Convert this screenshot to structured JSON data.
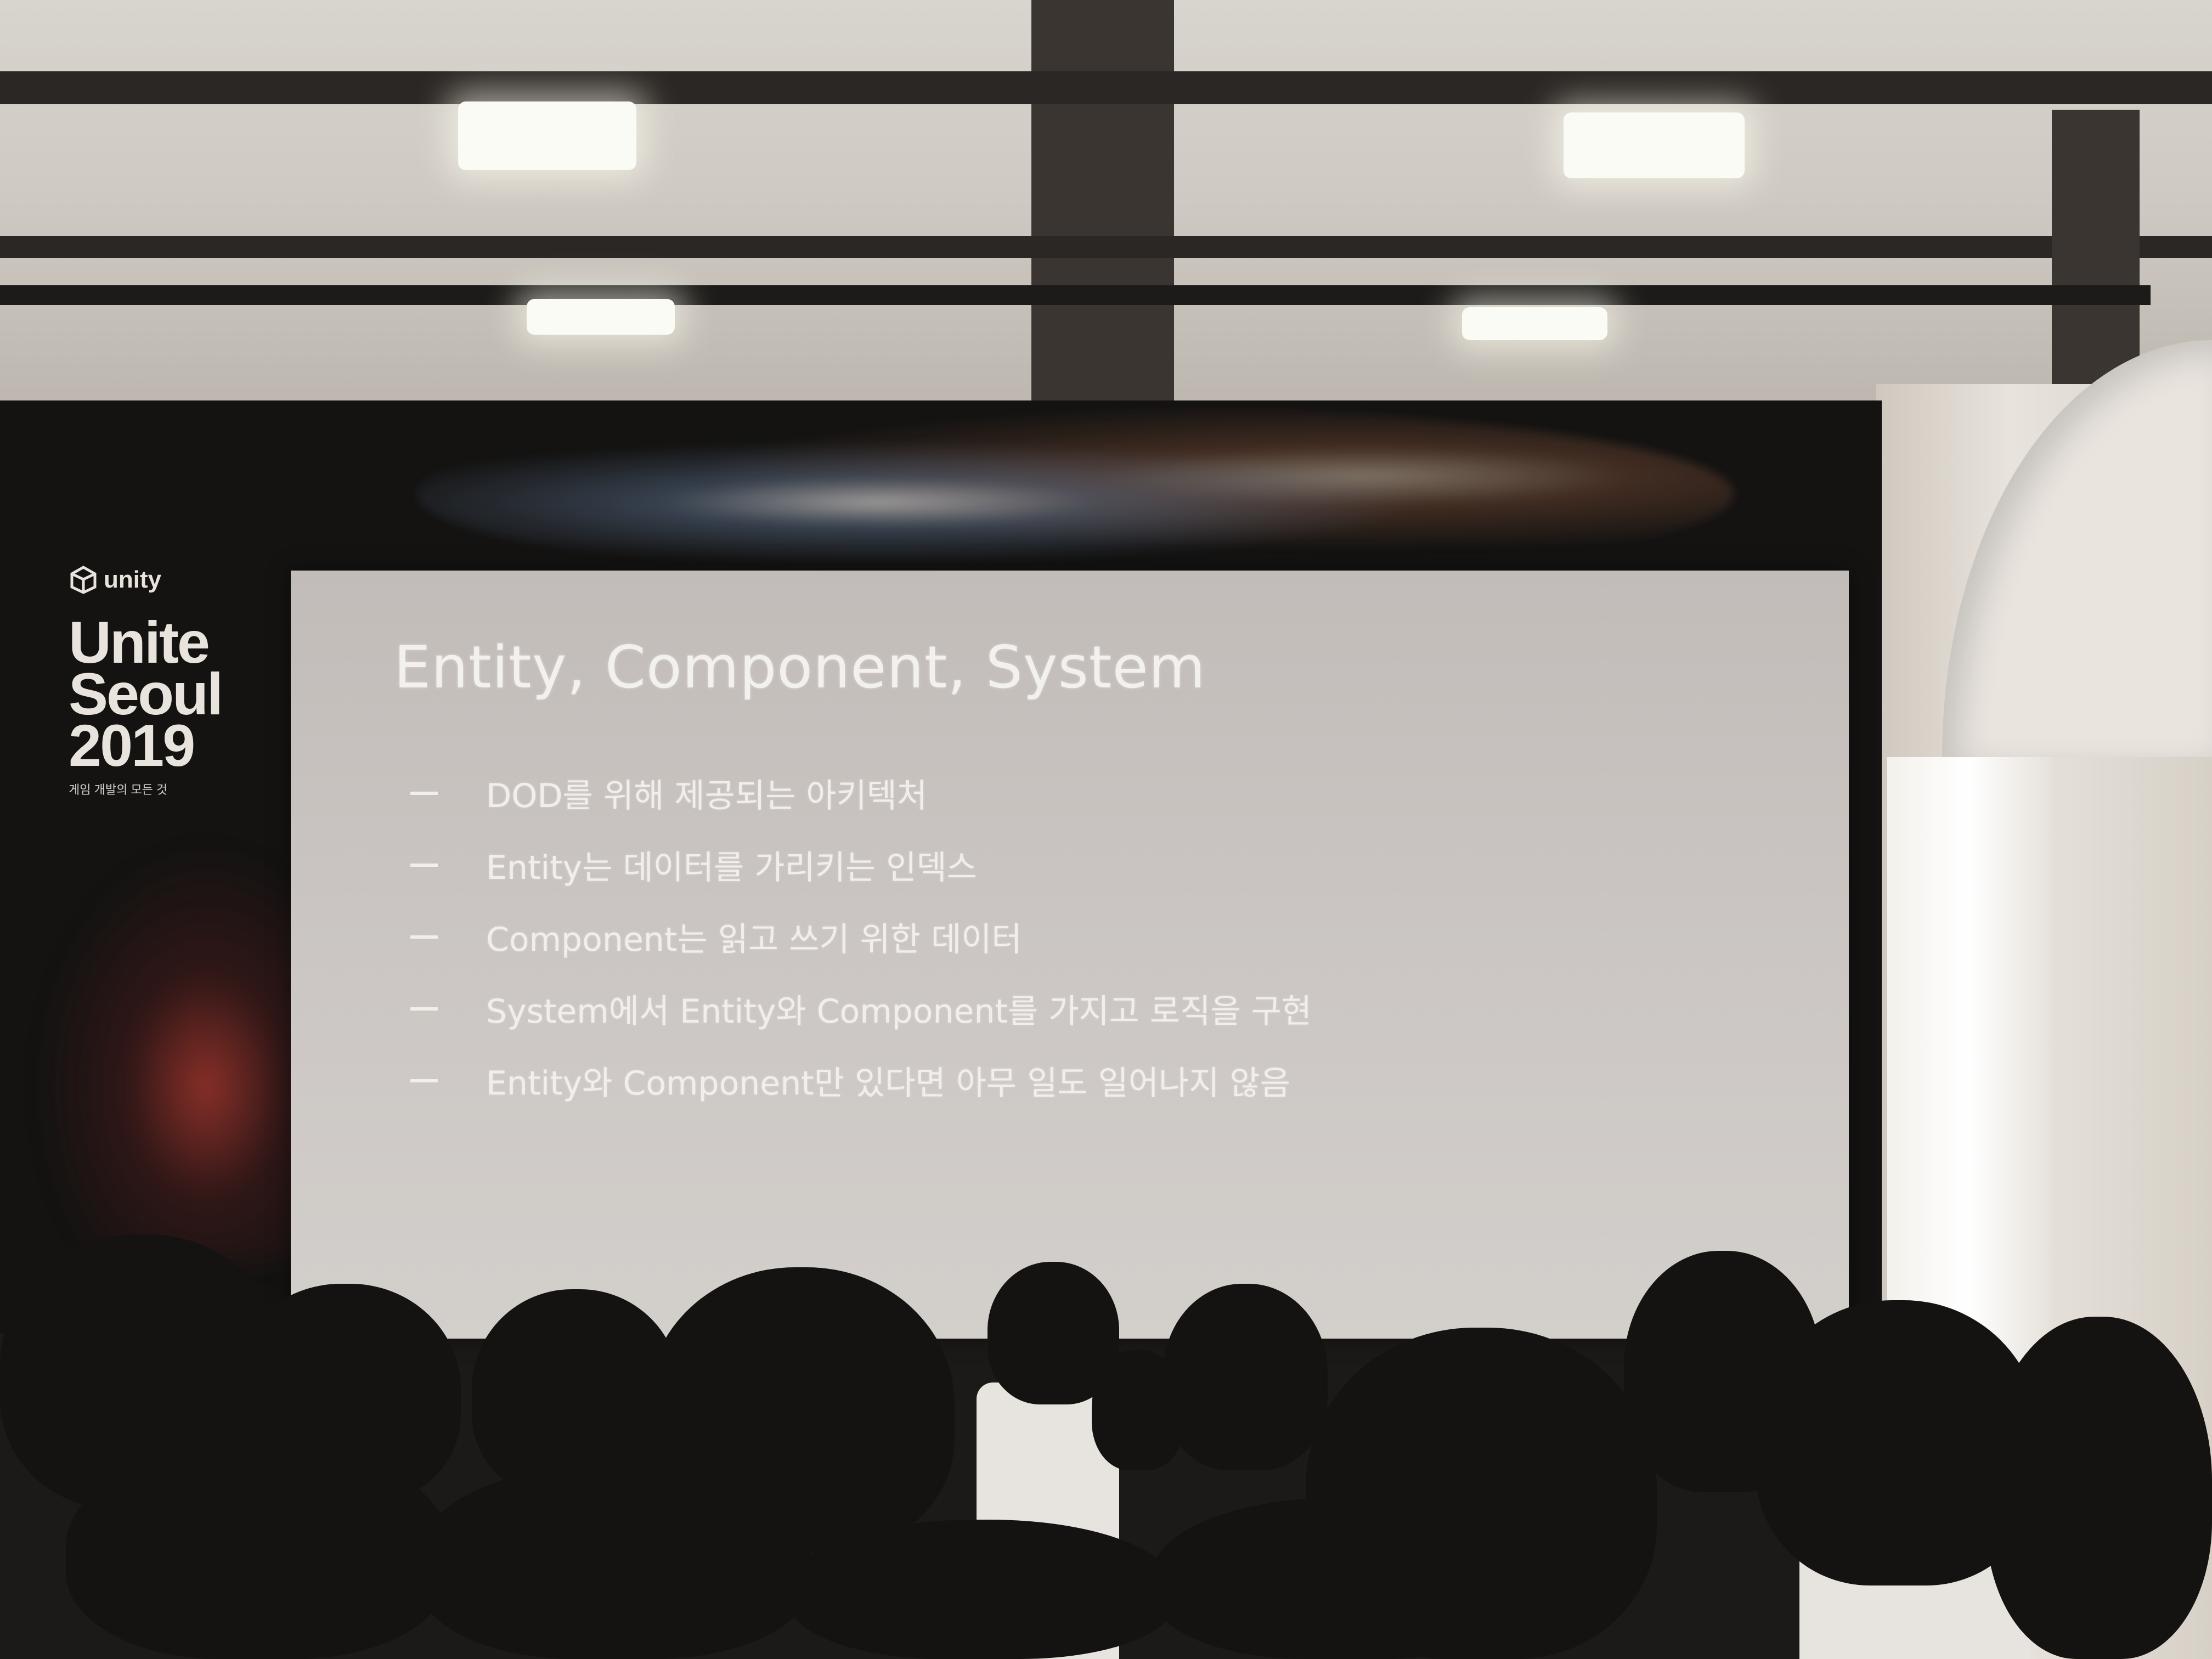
{
  "event_branding": {
    "logo_text": "unity",
    "line1": "Unite",
    "line2": "Seoul",
    "year": "2019",
    "tagline": "게임 개발의 모든 것"
  },
  "slide": {
    "title": "Entity, Component, System",
    "bullets": [
      "DOD를 위해 제공되는 아키텍처",
      "Entity는 데이터를 가리키는 인덱스",
      "Component는 읽고 쓰기 위한 데이터",
      "System에서 Entity와 Component를 가지고 로직을 구현",
      "Entity와 Component만 있다면 아무 일도 일어나지 않음"
    ]
  },
  "colors": {
    "backdrop": "#141312",
    "screen": "#cbc6c3",
    "slide_text": "#f2efeb"
  }
}
